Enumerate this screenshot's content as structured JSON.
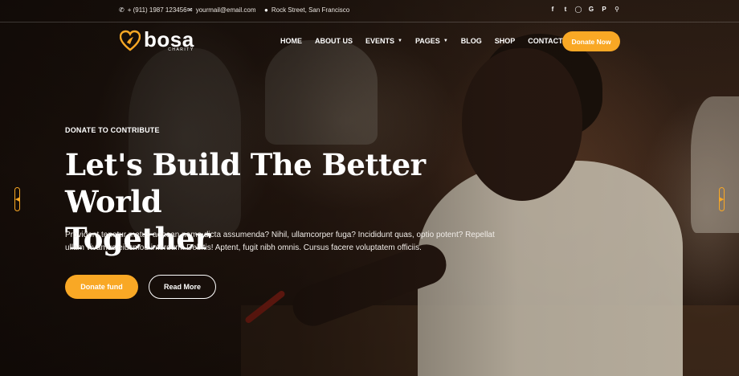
{
  "topbar": {
    "phone": "+ (911) 1987 123456",
    "email": "yourmail@email.com",
    "address": "Rock Street, San Francisco",
    "social_icons": [
      "facebook-icon",
      "twitter-icon",
      "instagram-icon",
      "google-icon",
      "pinterest-icon",
      "search-icon"
    ]
  },
  "logo": {
    "name": "bosa",
    "tagline": "CHARITY"
  },
  "nav": {
    "items": [
      {
        "label": "HOME",
        "dropdown": false
      },
      {
        "label": "ABOUT US",
        "dropdown": false
      },
      {
        "label": "EVENTS",
        "dropdown": true
      },
      {
        "label": "PAGES",
        "dropdown": true
      },
      {
        "label": "BLOG",
        "dropdown": false
      },
      {
        "label": "SHOP",
        "dropdown": false
      },
      {
        "label": "CONTACT",
        "dropdown": false
      }
    ],
    "cta": "Donate Now"
  },
  "hero": {
    "eyebrow": "DONATE TO CONTRIBUTE",
    "headline_line1": "Let's Build The Better World",
    "headline_line2": "Together",
    "paragraph_line1": "Provident tenetur metus aenean nemo dicta assumenda? Nihil, ullamcorper fuga? Incididunt quas, optio potent? Repellat",
    "paragraph_line2": "ullam vivamus eiusmod interdum! Debitis! Aptent, fugit nibh omnis. Cursus facere voluptatem officiis.",
    "primary_button": "Donate fund",
    "secondary_button": "Read More"
  },
  "colors": {
    "accent": "#f9a825",
    "text": "#ffffff"
  }
}
